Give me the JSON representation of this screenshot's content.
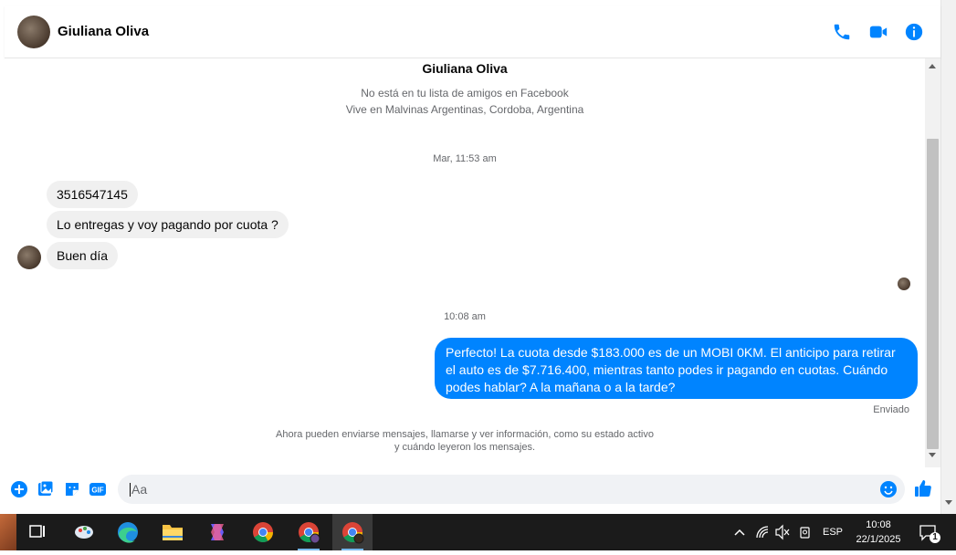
{
  "header": {
    "contact_name": "Giuliana Oliva",
    "icons": [
      "phone-icon",
      "video-icon",
      "info-icon"
    ]
  },
  "profile": {
    "name": "Giuliana Oliva",
    "not_friends": "No está en tu lista de amigos en Facebook",
    "location": "Vive en Malvinas Argentinas, Cordoba, Argentina"
  },
  "timestamps": {
    "first": "Mar, 11:53 am",
    "second": "10:08 am"
  },
  "messages": {
    "incoming": [
      {
        "text": "3516547145"
      },
      {
        "text": "Lo entregas y voy pagando por cuota ?"
      },
      {
        "text": "Buen día"
      }
    ],
    "outgoing": {
      "text": "Perfecto! La cuota desde $183.000 es de un MOBI 0KM. El anticipo para retirar el auto es de $7.716.400, mientras tanto podes ir pagando en cuotas. Cuándo podes hablar? A la mañana o a la tarde?",
      "status": "Enviado"
    }
  },
  "notice": {
    "line1": "Ahora pueden enviarse mensajes, llamarse y ver información, como su estado activo",
    "line2": "y cuándo leyeron los mensajes."
  },
  "composer": {
    "placeholder": "Aa",
    "icons": [
      "plus-icon",
      "image-icon",
      "sticker-icon",
      "gif-icon",
      "emoji-icon",
      "like-icon"
    ],
    "gif_label": "GIF"
  },
  "colors": {
    "messenger_blue": "#0084ff",
    "bubble_gray": "#f0f0f0",
    "taskbar": "#1b1b1b"
  },
  "taskbar": {
    "language": "ESP",
    "time": "10:08",
    "date": "22/1/2025",
    "notifications": "1",
    "apps": [
      "task-view-icon",
      "paint-icon",
      "edge-icon",
      "file-explorer-icon",
      "copilot-icon",
      "chrome-icon",
      "chrome-profile-icon",
      "chrome-profile-icon-2"
    ]
  }
}
